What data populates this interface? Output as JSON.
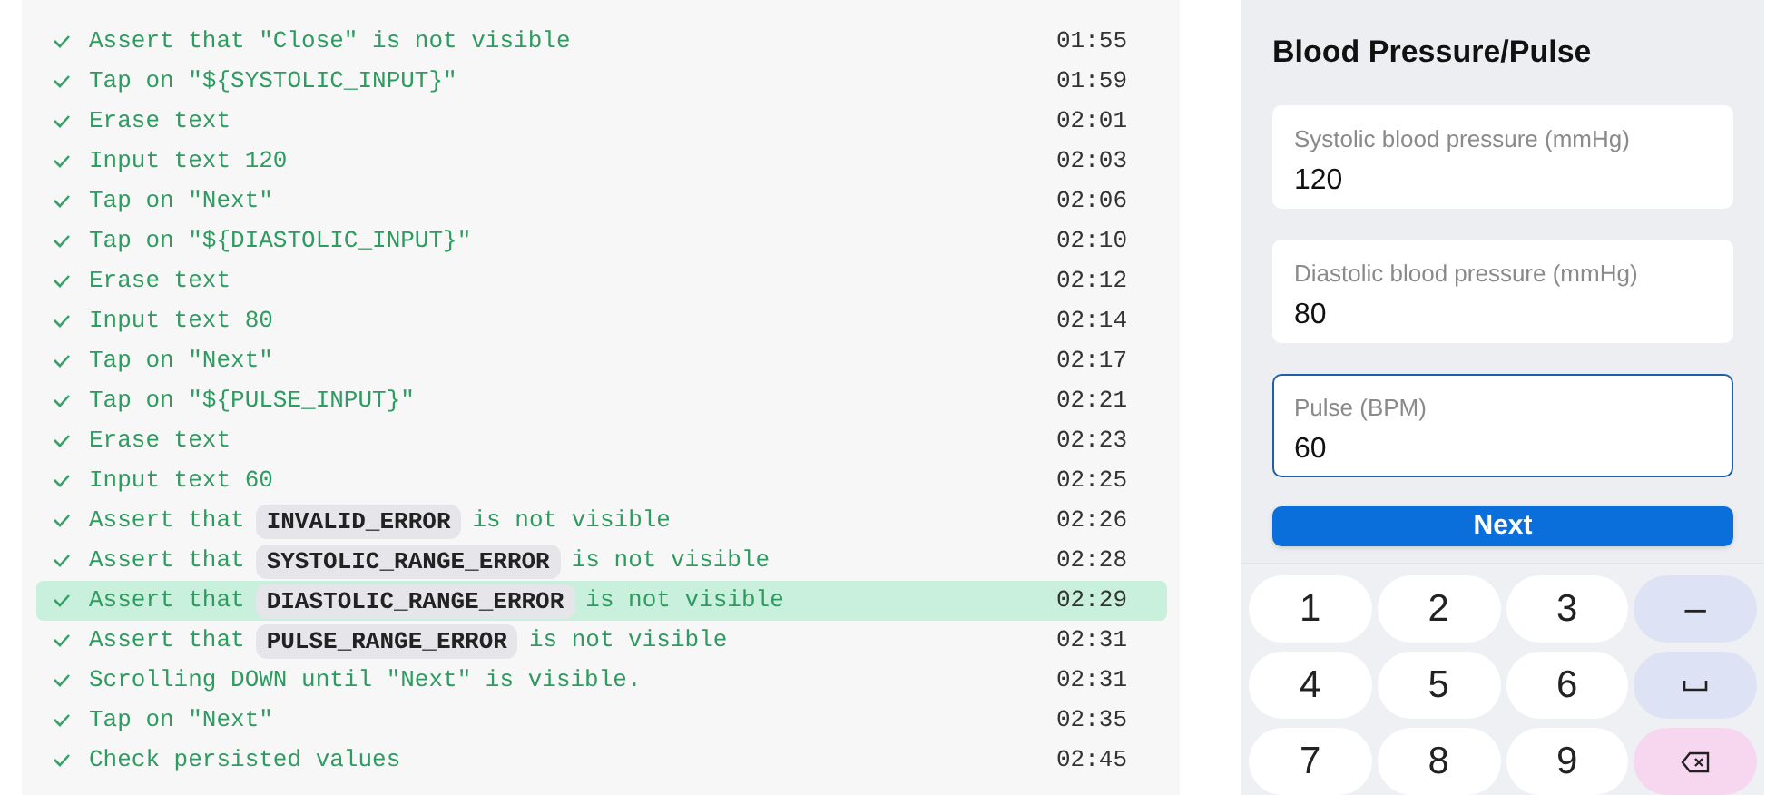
{
  "log": {
    "steps": [
      {
        "parts": [
          {
            "kind": "text",
            "text": "Assert that \"Close\" is not visible"
          }
        ],
        "time": "01:55",
        "selected": false
      },
      {
        "parts": [
          {
            "kind": "text",
            "text": "Tap on \"${SYSTOLIC_INPUT}\""
          }
        ],
        "time": "01:59",
        "selected": false
      },
      {
        "parts": [
          {
            "kind": "text",
            "text": "Erase text"
          }
        ],
        "time": "02:01",
        "selected": false
      },
      {
        "parts": [
          {
            "kind": "text",
            "text": "Input text 120"
          }
        ],
        "time": "02:03",
        "selected": false
      },
      {
        "parts": [
          {
            "kind": "text",
            "text": "Tap on \"Next\""
          }
        ],
        "time": "02:06",
        "selected": false
      },
      {
        "parts": [
          {
            "kind": "text",
            "text": "Tap on \"${DIASTOLIC_INPUT}\""
          }
        ],
        "time": "02:10",
        "selected": false
      },
      {
        "parts": [
          {
            "kind": "text",
            "text": "Erase text"
          }
        ],
        "time": "02:12",
        "selected": false
      },
      {
        "parts": [
          {
            "kind": "text",
            "text": "Input text 80"
          }
        ],
        "time": "02:14",
        "selected": false
      },
      {
        "parts": [
          {
            "kind": "text",
            "text": "Tap on \"Next\""
          }
        ],
        "time": "02:17",
        "selected": false
      },
      {
        "parts": [
          {
            "kind": "text",
            "text": "Tap on \"${PULSE_INPUT}\""
          }
        ],
        "time": "02:21",
        "selected": false
      },
      {
        "parts": [
          {
            "kind": "text",
            "text": "Erase text"
          }
        ],
        "time": "02:23",
        "selected": false
      },
      {
        "parts": [
          {
            "kind": "text",
            "text": "Input text 60"
          }
        ],
        "time": "02:25",
        "selected": false
      },
      {
        "parts": [
          {
            "kind": "text",
            "text": "Assert that"
          },
          {
            "kind": "code",
            "text": "INVALID_ERROR"
          },
          {
            "kind": "text",
            "text": "is not visible"
          }
        ],
        "time": "02:26",
        "selected": false
      },
      {
        "parts": [
          {
            "kind": "text",
            "text": "Assert that"
          },
          {
            "kind": "code",
            "text": "SYSTOLIC_RANGE_ERROR"
          },
          {
            "kind": "text",
            "text": "is not visible"
          }
        ],
        "time": "02:28",
        "selected": false
      },
      {
        "parts": [
          {
            "kind": "text",
            "text": "Assert that"
          },
          {
            "kind": "code",
            "text": "DIASTOLIC_RANGE_ERROR"
          },
          {
            "kind": "text",
            "text": "is not visible"
          }
        ],
        "time": "02:29",
        "selected": true
      },
      {
        "parts": [
          {
            "kind": "text",
            "text": "Assert that"
          },
          {
            "kind": "code",
            "text": "PULSE_RANGE_ERROR"
          },
          {
            "kind": "text",
            "text": "is not visible"
          }
        ],
        "time": "02:31",
        "selected": false
      },
      {
        "parts": [
          {
            "kind": "text",
            "text": "Scrolling DOWN until \"Next\" is visible."
          }
        ],
        "time": "02:31",
        "selected": false
      },
      {
        "parts": [
          {
            "kind": "text",
            "text": "Tap on \"Next\""
          }
        ],
        "time": "02:35",
        "selected": false
      },
      {
        "parts": [
          {
            "kind": "text",
            "text": "Check persisted values"
          }
        ],
        "time": "02:45",
        "selected": false
      }
    ]
  },
  "phone": {
    "title": "Blood Pressure/Pulse",
    "fields": [
      {
        "label": "Systolic blood pressure (mmHg)",
        "value": "120",
        "focused": false
      },
      {
        "label": "Diastolic blood pressure (mmHg)",
        "value": "80",
        "focused": false
      },
      {
        "label": "Pulse (BPM)",
        "value": "60",
        "focused": true
      }
    ],
    "button": "Next",
    "keys": [
      {
        "kind": "digit",
        "text": "1"
      },
      {
        "kind": "digit",
        "text": "2"
      },
      {
        "kind": "digit",
        "text": "3"
      },
      {
        "kind": "symbol",
        "text": "–"
      },
      {
        "kind": "digit",
        "text": "4"
      },
      {
        "kind": "digit",
        "text": "5"
      },
      {
        "kind": "digit",
        "text": "6"
      },
      {
        "kind": "space"
      },
      {
        "kind": "digit",
        "text": "7"
      },
      {
        "kind": "digit",
        "text": "8"
      },
      {
        "kind": "digit",
        "text": "9"
      },
      {
        "kind": "backspace"
      }
    ]
  }
}
